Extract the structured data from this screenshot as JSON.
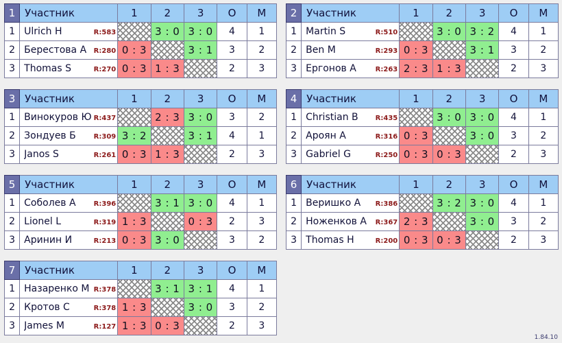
{
  "page": {
    "background_color": "#efefef",
    "version_label": "1.84.10"
  },
  "theme": {
    "header_number_bg": "#6a6fa8",
    "header_bg": "#9ecdf5",
    "win_bg": "#90ee90",
    "loss_bg": "#fa8a8a",
    "rating_color": "#8c1a1a",
    "border_color": "#7a7a9c"
  },
  "columns": {
    "participant": "Участник",
    "c1": "1",
    "c2": "2",
    "c3": "3",
    "points": "О",
    "place": "М"
  },
  "groups": [
    {
      "number": "1",
      "rows": [
        {
          "rank": "1",
          "name": "Ulrich H",
          "rating": "R:583",
          "cells": [
            {
              "text": "",
              "state": "self"
            },
            {
              "text": "3 : 0",
              "state": "win"
            },
            {
              "text": "3 : 0",
              "state": "win"
            }
          ],
          "points": "4",
          "place": "1"
        },
        {
          "rank": "2",
          "name": "Берестова А",
          "rating": "R:280",
          "cells": [
            {
              "text": "0 : 3",
              "state": "loss"
            },
            {
              "text": "",
              "state": "self"
            },
            {
              "text": "3 : 1",
              "state": "win"
            }
          ],
          "points": "3",
          "place": "2"
        },
        {
          "rank": "3",
          "name": "Thomas S",
          "rating": "R:270",
          "cells": [
            {
              "text": "0 : 3",
              "state": "loss"
            },
            {
              "text": "1 : 3",
              "state": "loss"
            },
            {
              "text": "",
              "state": "self"
            }
          ],
          "points": "2",
          "place": "3"
        }
      ]
    },
    {
      "number": "2",
      "rows": [
        {
          "rank": "1",
          "name": "Martin S",
          "rating": "R:510",
          "cells": [
            {
              "text": "",
              "state": "self"
            },
            {
              "text": "3 : 0",
              "state": "win"
            },
            {
              "text": "3 : 2",
              "state": "win"
            }
          ],
          "points": "4",
          "place": "1"
        },
        {
          "rank": "2",
          "name": "Ben M",
          "rating": "R:293",
          "cells": [
            {
              "text": "0 : 3",
              "state": "loss"
            },
            {
              "text": "",
              "state": "self"
            },
            {
              "text": "3 : 1",
              "state": "win"
            }
          ],
          "points": "3",
          "place": "2"
        },
        {
          "rank": "3",
          "name": "Ергонов А",
          "rating": "R:263",
          "cells": [
            {
              "text": "2 : 3",
              "state": "loss"
            },
            {
              "text": "1 : 3",
              "state": "loss"
            },
            {
              "text": "",
              "state": "self"
            }
          ],
          "points": "2",
          "place": "3"
        }
      ]
    },
    {
      "number": "3",
      "rows": [
        {
          "rank": "1",
          "name": "Винокуров Ю",
          "rating": "R:437",
          "cells": [
            {
              "text": "",
              "state": "self"
            },
            {
              "text": "2 : 3",
              "state": "loss"
            },
            {
              "text": "3 : 0",
              "state": "win"
            }
          ],
          "points": "3",
          "place": "2"
        },
        {
          "rank": "2",
          "name": "Зондуев Б",
          "rating": "R:309",
          "cells": [
            {
              "text": "3 : 2",
              "state": "win"
            },
            {
              "text": "",
              "state": "self"
            },
            {
              "text": "3 : 1",
              "state": "win"
            }
          ],
          "points": "4",
          "place": "1"
        },
        {
          "rank": "3",
          "name": "Janos S",
          "rating": "R:261",
          "cells": [
            {
              "text": "0 : 3",
              "state": "loss"
            },
            {
              "text": "1 : 3",
              "state": "loss"
            },
            {
              "text": "",
              "state": "self"
            }
          ],
          "points": "2",
          "place": "3"
        }
      ]
    },
    {
      "number": "4",
      "rows": [
        {
          "rank": "1",
          "name": "Christian B",
          "rating": "R:435",
          "cells": [
            {
              "text": "",
              "state": "self"
            },
            {
              "text": "3 : 0",
              "state": "win"
            },
            {
              "text": "3 : 0",
              "state": "win"
            }
          ],
          "points": "4",
          "place": "1"
        },
        {
          "rank": "2",
          "name": "Ароян А",
          "rating": "R:316",
          "cells": [
            {
              "text": "0 : 3",
              "state": "loss"
            },
            {
              "text": "",
              "state": "self"
            },
            {
              "text": "3 : 0",
              "state": "win"
            }
          ],
          "points": "3",
          "place": "2"
        },
        {
          "rank": "3",
          "name": "Gabriel G",
          "rating": "R:250",
          "cells": [
            {
              "text": "0 : 3",
              "state": "loss"
            },
            {
              "text": "0 : 3",
              "state": "loss"
            },
            {
              "text": "",
              "state": "self"
            }
          ],
          "points": "2",
          "place": "3"
        }
      ]
    },
    {
      "number": "5",
      "rows": [
        {
          "rank": "1",
          "name": "Соболев А",
          "rating": "R:396",
          "cells": [
            {
              "text": "",
              "state": "self"
            },
            {
              "text": "3 : 1",
              "state": "win"
            },
            {
              "text": "3 : 0",
              "state": "win"
            }
          ],
          "points": "4",
          "place": "1"
        },
        {
          "rank": "2",
          "name": "Lionel L",
          "rating": "R:319",
          "cells": [
            {
              "text": "1 : 3",
              "state": "loss"
            },
            {
              "text": "",
              "state": "self"
            },
            {
              "text": "0 : 3",
              "state": "loss"
            }
          ],
          "points": "2",
          "place": "3"
        },
        {
          "rank": "3",
          "name": "Аринин И",
          "rating": "R:213",
          "cells": [
            {
              "text": "0 : 3",
              "state": "loss"
            },
            {
              "text": "3 : 0",
              "state": "win"
            },
            {
              "text": "",
              "state": "self"
            }
          ],
          "points": "3",
          "place": "2"
        }
      ]
    },
    {
      "number": "6",
      "rows": [
        {
          "rank": "1",
          "name": "Веришко А",
          "rating": "R:386",
          "cells": [
            {
              "text": "",
              "state": "self"
            },
            {
              "text": "3 : 2",
              "state": "win"
            },
            {
              "text": "3 : 0",
              "state": "win"
            }
          ],
          "points": "4",
          "place": "1"
        },
        {
          "rank": "2",
          "name": "Ноженков А",
          "rating": "R:367",
          "cells": [
            {
              "text": "2 : 3",
              "state": "loss"
            },
            {
              "text": "",
              "state": "self"
            },
            {
              "text": "3 : 0",
              "state": "win"
            }
          ],
          "points": "3",
          "place": "2"
        },
        {
          "rank": "3",
          "name": "Thomas H",
          "rating": "R:200",
          "cells": [
            {
              "text": "0 : 3",
              "state": "loss"
            },
            {
              "text": "0 : 3",
              "state": "loss"
            },
            {
              "text": "",
              "state": "self"
            }
          ],
          "points": "2",
          "place": "3"
        }
      ]
    },
    {
      "number": "7",
      "rows": [
        {
          "rank": "1",
          "name": "Назаренко М",
          "rating": "R:378",
          "cells": [
            {
              "text": "",
              "state": "self"
            },
            {
              "text": "3 : 1",
              "state": "win"
            },
            {
              "text": "3 : 1",
              "state": "win"
            }
          ],
          "points": "4",
          "place": "1"
        },
        {
          "rank": "2",
          "name": "Кротов С",
          "rating": "R:378",
          "cells": [
            {
              "text": "1 : 3",
              "state": "loss"
            },
            {
              "text": "",
              "state": "self"
            },
            {
              "text": "3 : 0",
              "state": "win"
            }
          ],
          "points": "3",
          "place": "2"
        },
        {
          "rank": "3",
          "name": "James M",
          "rating": "R:127",
          "cells": [
            {
              "text": "1 : 3",
              "state": "loss"
            },
            {
              "text": "0 : 3",
              "state": "loss"
            },
            {
              "text": "",
              "state": "self"
            }
          ],
          "points": "2",
          "place": "3"
        }
      ]
    }
  ]
}
